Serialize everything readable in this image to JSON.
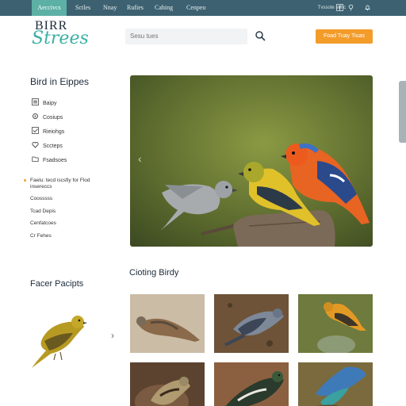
{
  "topnav": {
    "items": [
      {
        "label": "Aeccivcs",
        "active": true
      },
      {
        "label": "Sctles",
        "active": false
      },
      {
        "label": "Nnay",
        "active": false
      },
      {
        "label": "Rufies",
        "active": false
      },
      {
        "label": "Cahing",
        "active": false
      },
      {
        "label": "Cenpeo",
        "active": false
      }
    ],
    "right_text": "Tvssote sttnc",
    "icons": [
      "facebook-icon",
      "pin-icon",
      "notification-icon"
    ]
  },
  "header": {
    "logo_top": "BIRR",
    "logo_script": "Strees",
    "search_placeholder": "Sesu tues",
    "cta_label": "Foad Tuay Tiuas"
  },
  "sidebar": {
    "title": "Bird in Eippes",
    "categories": [
      {
        "label": "Baipy",
        "icon": "list-icon"
      },
      {
        "label": "Cosiups",
        "icon": "gear-icon"
      },
      {
        "label": "Rieiohgs",
        "icon": "check-icon"
      },
      {
        "label": "Sccteps",
        "icon": "heart-icon"
      },
      {
        "label": "Fsadsoes",
        "icon": "folder-icon"
      }
    ],
    "subsection": {
      "lines": [
        "Faelu: tecd iscsfiy for Flod",
        "insereccs"
      ],
      "items": [
        "Coosssss",
        "Tcad Depis",
        "Cenfatcoes",
        "Cr Fehes"
      ]
    }
  },
  "featured": {
    "title": "Facer Pacipts"
  },
  "gallery": {
    "title": "Cioting Birdy"
  },
  "colors": {
    "topbar": "#3d6170",
    "accent_teal": "#5db0a6",
    "cta_orange": "#f39c2a"
  }
}
